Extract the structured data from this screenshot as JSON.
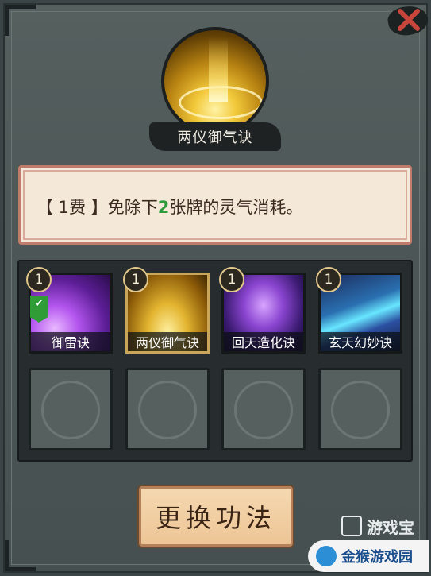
{
  "skill": {
    "name": "两仪御气诀",
    "description_prefix": "【 1费 】免除下",
    "description_number": "2",
    "description_suffix": "张牌的灵气消耗。"
  },
  "cards": [
    {
      "name": "御雷诀",
      "cost": "1",
      "equipped": true,
      "art": "thunder"
    },
    {
      "name": "两仪御气诀",
      "cost": "1",
      "selected": true,
      "art": "gold"
    },
    {
      "name": "回天造化诀",
      "cost": "1",
      "art": "heaven"
    },
    {
      "name": "玄天幻妙诀",
      "cost": "1",
      "art": "mystic"
    }
  ],
  "change_button": {
    "label": "更换功法"
  },
  "icons": {
    "close": "close-x-icon",
    "equipped": "checkmark-icon"
  },
  "colors": {
    "highlight_number": "#2f9a3c",
    "desc_border": "#c07c6a",
    "button_bg": "#f0cc9e"
  },
  "watermarks": {
    "site1": "游戏宝",
    "site2": "金猴游戏园"
  }
}
